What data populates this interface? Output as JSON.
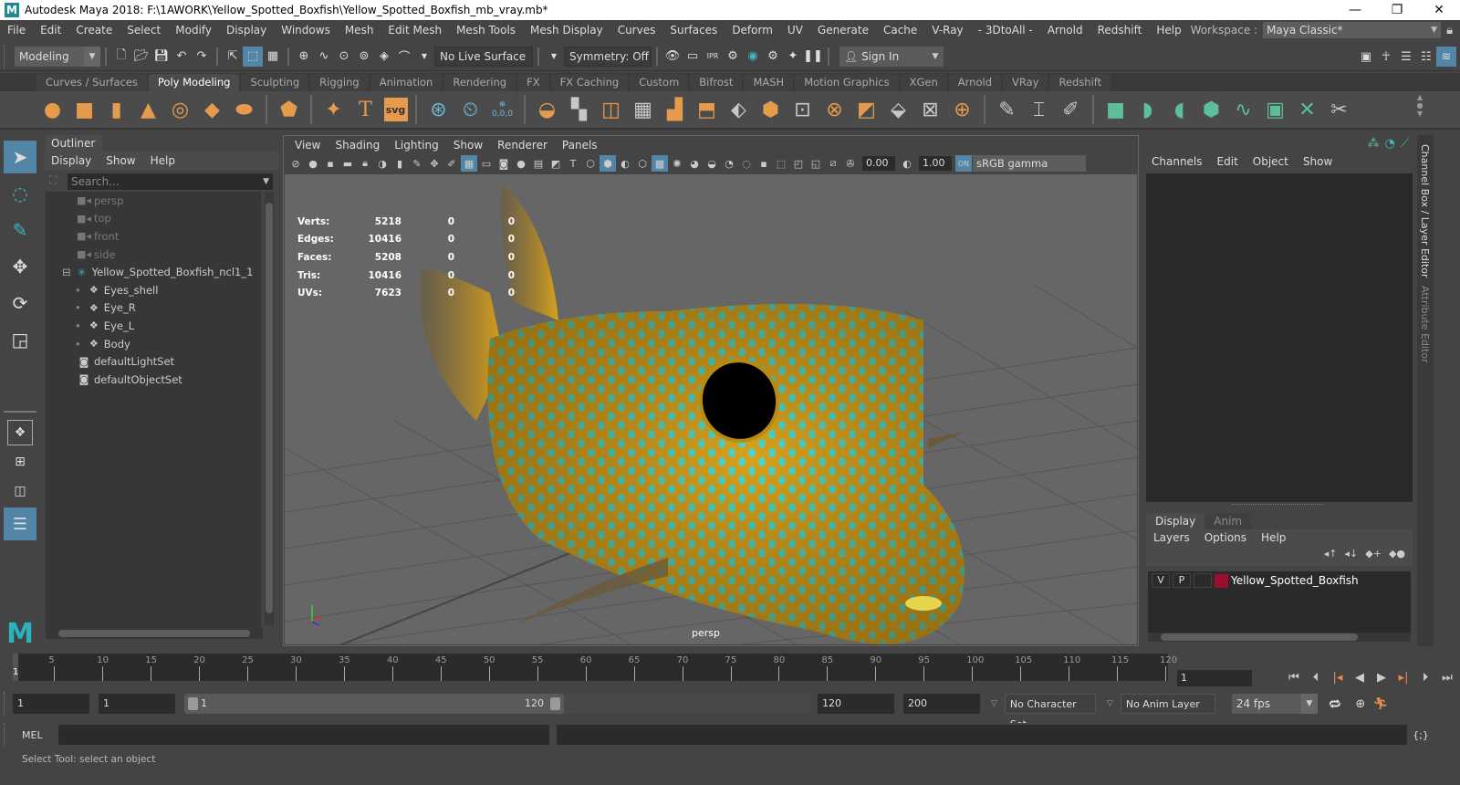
{
  "window": {
    "app_logo": "M",
    "title": "Autodesk Maya 2018: F:\\1AWORK\\Yellow_Spotted_Boxfish\\Yellow_Spotted_Boxfish_mb_vray.mb*",
    "controls": {
      "minimize": "—",
      "restore": "❐",
      "close": "✕"
    }
  },
  "menubar": [
    "File",
    "Edit",
    "Create",
    "Select",
    "Modify",
    "Display",
    "Windows",
    "Mesh",
    "Edit Mesh",
    "Mesh Tools",
    "Mesh Display",
    "Curves",
    "Surfaces",
    "Deform",
    "UV",
    "Generate",
    "Cache",
    "V-Ray",
    "- 3DtoAll -",
    "Arnold",
    "Redshift",
    "Help"
  ],
  "workspace": {
    "label": "Workspace :",
    "value": "Maya Classic*",
    "lock_icon": "lock-icon"
  },
  "statusline": {
    "mode": "Modeling",
    "live_surface": "No Live Surface",
    "symmetry": "Symmetry: Off",
    "sign_in": "Sign In"
  },
  "shelf": {
    "tabs": [
      "Curves / Surfaces",
      "Poly Modeling",
      "Sculpting",
      "Rigging",
      "Animation",
      "Rendering",
      "FX",
      "FX Caching",
      "Custom",
      "Bifrost",
      "MASH",
      "Motion Graphics",
      "XGen",
      "Arnold",
      "VRay",
      "Redshift"
    ],
    "active_tab": "Poly Modeling",
    "svg_label": "svg",
    "text_label": "T",
    "coord_label": "0,0,0"
  },
  "outliner": {
    "tab": "Outliner",
    "menu": [
      "Display",
      "Show",
      "Help"
    ],
    "search_placeholder": "Search...",
    "items": [
      {
        "label": "persp",
        "icon": "camera-icon",
        "dim": true,
        "indent": 1
      },
      {
        "label": "top",
        "icon": "camera-icon",
        "dim": true,
        "indent": 1
      },
      {
        "label": "front",
        "icon": "camera-icon",
        "dim": true,
        "indent": 1
      },
      {
        "label": "side",
        "icon": "camera-icon",
        "dim": true,
        "indent": 1
      },
      {
        "label": "Yellow_Spotted_Boxfish_ncl1_1",
        "icon": "group-icon",
        "dim": false,
        "indent": 0,
        "expander": "⊟"
      },
      {
        "label": "Eyes_shell",
        "icon": "mesh-icon",
        "dim": false,
        "indent": 2
      },
      {
        "label": "Eye_R",
        "icon": "mesh-icon",
        "dim": false,
        "indent": 2
      },
      {
        "label": "Eye_L",
        "icon": "mesh-icon",
        "dim": false,
        "indent": 2
      },
      {
        "label": "Body",
        "icon": "mesh-icon",
        "dim": false,
        "indent": 2
      },
      {
        "label": "defaultLightSet",
        "icon": "set-icon",
        "dim": false,
        "indent": 1
      },
      {
        "label": "defaultObjectSet",
        "icon": "set-icon",
        "dim": false,
        "indent": 1
      }
    ]
  },
  "viewport": {
    "menu": [
      "View",
      "Shading",
      "Lighting",
      "Show",
      "Renderer",
      "Panels"
    ],
    "exposure": "0.00",
    "gamma": "1.00",
    "color_space": "sRGB gamma",
    "camera_label": "persp",
    "hud": [
      {
        "label": "Verts:",
        "v1": "5218",
        "v2": "0",
        "v3": "0"
      },
      {
        "label": "Edges:",
        "v1": "10416",
        "v2": "0",
        "v3": "0"
      },
      {
        "label": "Faces:",
        "v1": "5208",
        "v2": "0",
        "v3": "0"
      },
      {
        "label": "Tris:",
        "v1": "10416",
        "v2": "0",
        "v3": "0"
      },
      {
        "label": "UVs:",
        "v1": "7623",
        "v2": "0",
        "v3": "0"
      }
    ]
  },
  "channel_box": {
    "menu": [
      "Channels",
      "Edit",
      "Object",
      "Show"
    ]
  },
  "layer_editor": {
    "tabs": [
      "Display",
      "Anim"
    ],
    "active_tab": "Display",
    "menu": [
      "Layers",
      "Options",
      "Help"
    ],
    "layers": [
      {
        "v": "V",
        "p": "P",
        "name": "Yellow_Spotted_Boxfish",
        "color": "#9b0f2e"
      }
    ]
  },
  "side_tabs": {
    "channel_box": "Channel Box / Layer Editor",
    "attribute_editor": "Attribute Editor"
  },
  "timeline": {
    "current_frame": "1",
    "ticks": [
      "5",
      "10",
      "15",
      "20",
      "25",
      "30",
      "35",
      "40",
      "45",
      "50",
      "55",
      "60",
      "65",
      "70",
      "75",
      "80",
      "85",
      "90",
      "95",
      "100",
      "105",
      "110",
      "115",
      "120"
    ],
    "frame_field": "1"
  },
  "range": {
    "start": "1",
    "anim_start": "1",
    "slider_start": "1",
    "slider_end": "120",
    "end": "120",
    "anim_end": "200",
    "character_set": "No Character Set",
    "anim_layer": "No Anim Layer",
    "fps": "24 fps"
  },
  "command": {
    "label": "MEL"
  },
  "help_line": "Select Tool: select an object",
  "colors": {
    "accent": "#5285a6",
    "shelf_orange": "#e69a4c",
    "teal": "#5cbf9a",
    "fish_body": "#d9a21c",
    "fish_spot": "#4fd6c8"
  }
}
